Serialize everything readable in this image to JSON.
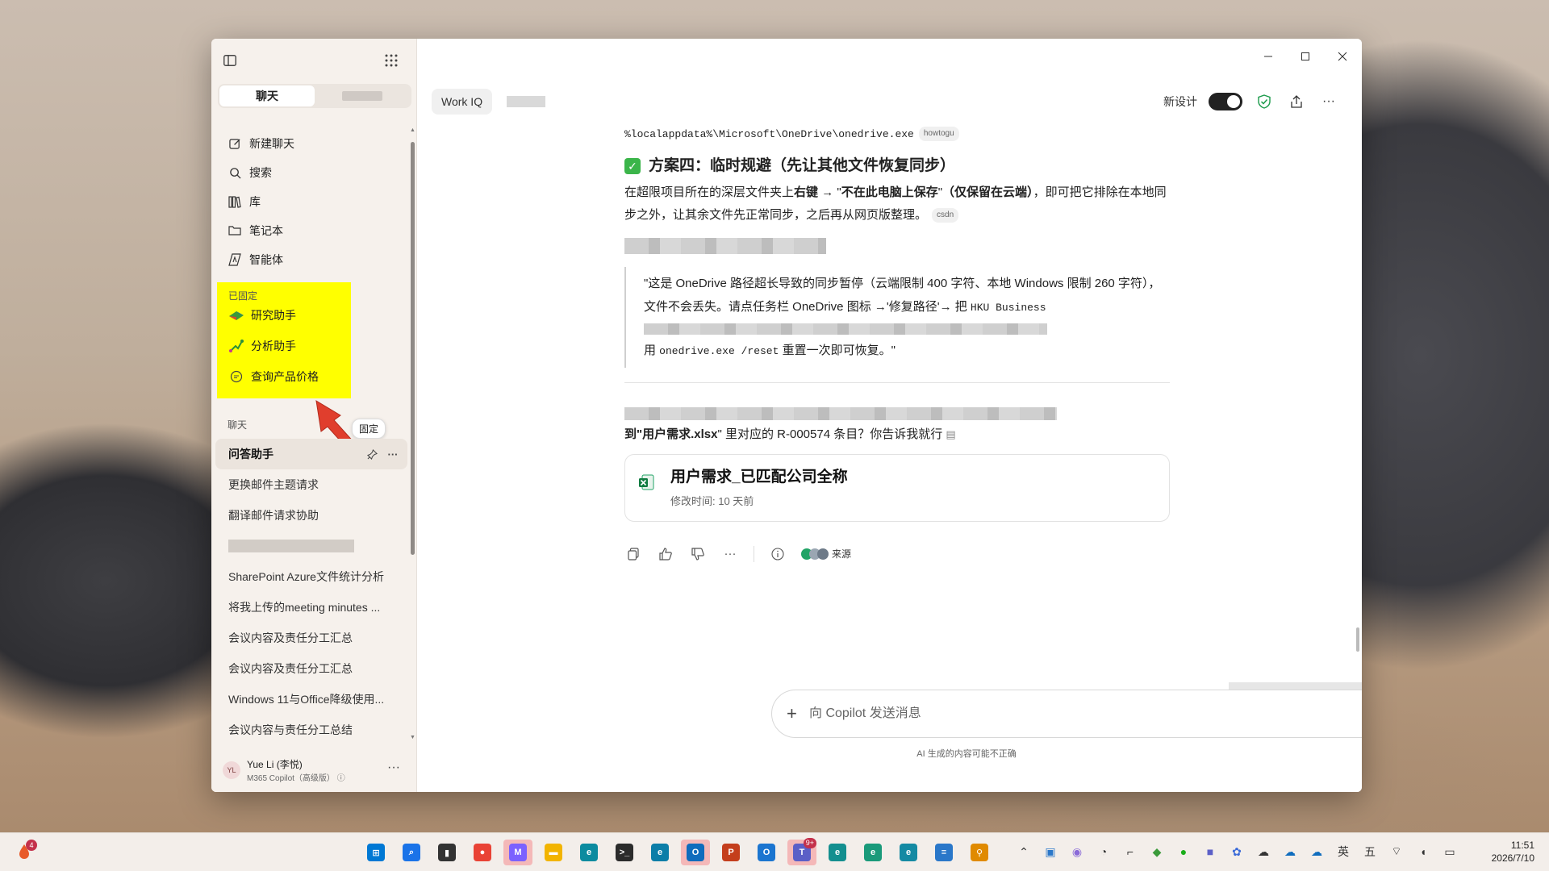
{
  "sidebar": {
    "tabs": [
      {
        "label": "聊天"
      },
      {
        "label": ""
      }
    ],
    "nav": [
      {
        "label": "新建聊天",
        "icon": "edit-icon"
      },
      {
        "label": "搜索",
        "icon": "search-icon"
      },
      {
        "label": "库",
        "icon": "library-icon"
      },
      {
        "label": "笔记本",
        "icon": "folder-icon"
      },
      {
        "label": "智能体",
        "icon": "agent-icon"
      }
    ],
    "pinned_heading": "已固定",
    "pinned": [
      {
        "label": "研究助手"
      },
      {
        "label": "分析助手"
      },
      {
        "label": "查询产品价格"
      }
    ],
    "chats_heading": "聊天",
    "tooltip": "固定",
    "chats": [
      {
        "label": "问答助手"
      },
      {
        "label": "更换邮件主题请求"
      },
      {
        "label": "翻译邮件请求协助"
      },
      {
        "label": ""
      },
      {
        "label": "SharePoint Azure文件统计分析"
      },
      {
        "label": "将我上传的meeting minutes ..."
      },
      {
        "label": "会议内容及责任分工汇总"
      },
      {
        "label": "会议内容及责任分工汇总"
      },
      {
        "label": "Windows 11与Office降级使用..."
      },
      {
        "label": "会议内容与责任分工总结"
      }
    ],
    "user": {
      "initials": "YL",
      "name": "Yue Li (李悦)",
      "plan": "M365 Copilot（高级版）"
    }
  },
  "header": {
    "agent_chip": "Work IQ",
    "new_design_label": "新设计",
    "new_design_on": true
  },
  "message": {
    "path_line": "%localappdata%\\Microsoft\\OneDrive\\onedrive.exe",
    "path_cite": "howtogu",
    "heading4": "方案四：临时规避（先让其他文件恢复同步）",
    "p1_a": "在超限项目所在的深层文件夹上",
    "p1_b": "右键",
    "p1_c": " → \"",
    "p1_d": "不在此电脑上保存",
    "p1_e": "\"",
    "p1_f": "（仅保留在云端）",
    "p1_g": "，即可把它排除在本地同步之外，让其余文件先正常同步，之后再从网页版整理。",
    "p1_cite": "csdn",
    "quote_1": "\"这是 OneDrive 路径超长导致的同步暂停（云端限制 400 字符、本地 Windows 限制 260 字符），文件不会丢失。请点任务栏 OneDrive 图标 →'修复路径'→ 把 ",
    "quote_1_mono": "HKU Business",
    "quote_2a": "用 ",
    "quote_2_mono": "onedrive.exe /reset",
    "quote_2b": " 重置一次即可恢复。\"",
    "q_a": "到\"",
    "q_b": "用户需求.xlsx",
    "q_c": "\" 里对应的 R-000574 条目？你告诉我就行",
    "file_card": {
      "title": "用户需求_已匹配公司全称",
      "subtitle": "修改时间: 10 天前"
    },
    "sources_label": "来源"
  },
  "composer": {
    "placeholder": "向 Copilot 发送消息",
    "value": ""
  },
  "disclaimer": "AI 生成的内容可能不正确",
  "taskbar": {
    "left_badge": "4",
    "apps": [
      {
        "icon": "windows-start-icon",
        "color": "#0078d4",
        "glyph": "⊞"
      },
      {
        "icon": "search-icon",
        "color": "#1a73e8",
        "glyph": "⌕"
      },
      {
        "icon": "task-view-icon",
        "color": "#333333",
        "glyph": "▮"
      },
      {
        "icon": "chrome-icon",
        "color": "#e94235",
        "glyph": "●"
      },
      {
        "icon": "m365-copilot-icon",
        "color": "#7b61ff",
        "glyph": "M"
      },
      {
        "icon": "file-explorer-icon",
        "color": "#f2b400",
        "glyph": "▬"
      },
      {
        "icon": "edge-icon",
        "color": "#0c8b9f",
        "glyph": "e"
      },
      {
        "icon": "terminal-icon",
        "color": "#2b2b2b",
        "glyph": ">_"
      },
      {
        "icon": "edge-beta-icon",
        "color": "#0c7ea8",
        "glyph": "e"
      },
      {
        "icon": "outlook-icon",
        "color": "#0f6cbd",
        "glyph": "O"
      },
      {
        "icon": "powerpoint-icon",
        "color": "#c43e1c",
        "glyph": "P"
      },
      {
        "icon": "outlook-new-icon",
        "color": "#1b75d0",
        "glyph": "O"
      },
      {
        "icon": "teams-icon",
        "color": "#5b5fc7",
        "glyph": "T",
        "badge": "9+"
      },
      {
        "icon": "edge-dev-icon",
        "color": "#138f8f",
        "glyph": "e"
      },
      {
        "icon": "edge-canary-icon",
        "color": "#1a9a7a",
        "glyph": "e"
      },
      {
        "icon": "edge-alt-icon",
        "color": "#148aa3",
        "glyph": "e"
      },
      {
        "icon": "notepad-icon",
        "color": "#2a77c9",
        "glyph": "≡"
      },
      {
        "icon": "magnifier-icon",
        "color": "#e08a00",
        "glyph": "⚲"
      }
    ],
    "tray_input": "英",
    "tray_calendar": "五",
    "time": "11:51",
    "date": "2026/7/10"
  }
}
